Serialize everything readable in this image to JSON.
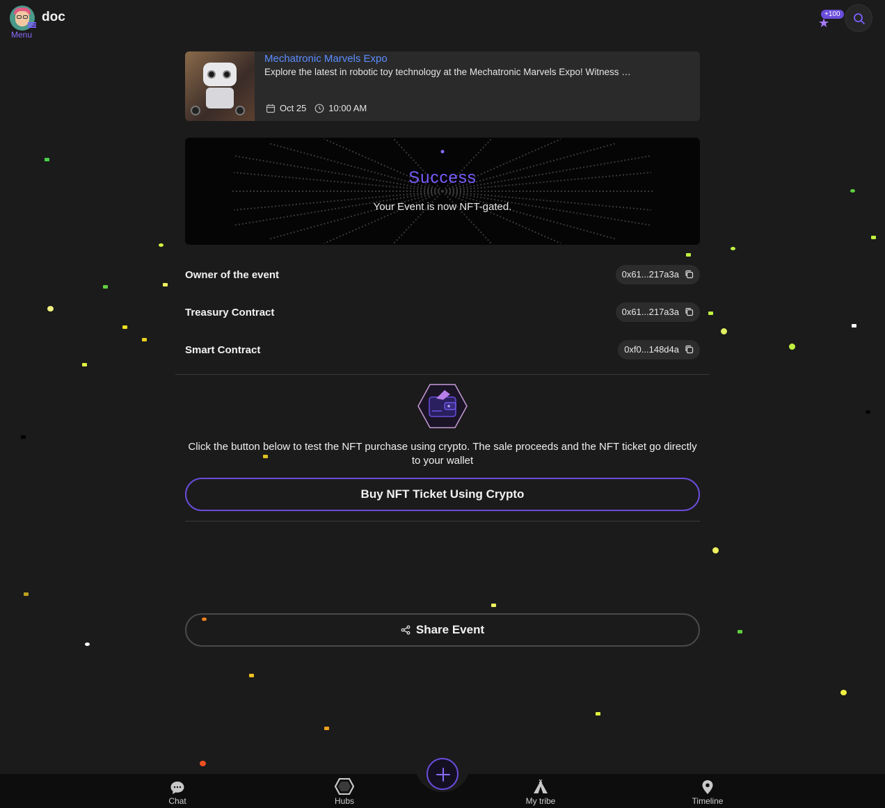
{
  "header": {
    "user_name": "doc",
    "menu_label": "Menu",
    "points_badge": "+100"
  },
  "event": {
    "title": "Mechatronic Marvels Expo",
    "description": "Explore the latest in robotic toy technology at the Mechatronic Marvels Expo! Witness …",
    "date": "Oct 25",
    "time": "10:00 AM"
  },
  "success": {
    "title": "Success",
    "message": "Your Event is now NFT-gated."
  },
  "contracts": [
    {
      "label": "Owner of the event",
      "address": "0x61...217a3a"
    },
    {
      "label": "Treasury Contract",
      "address": "0x61...217a3a"
    },
    {
      "label": "Smart Contract",
      "address": "0xf0...148d4a"
    }
  ],
  "purchase": {
    "info": "Click the button below to test the NFT purchase using crypto. The sale proceeds and the NFT ticket go directly to your wallet",
    "button_label": "Buy NFT Ticket Using Crypto"
  },
  "share": {
    "button_label": "Share Event"
  },
  "bottom_nav": {
    "items": [
      {
        "label": "Chat",
        "icon": "chat-bubble-icon"
      },
      {
        "label": "Hubs",
        "icon": "hexagon-icon"
      },
      {
        "label": "My tribe",
        "icon": "tent-icon"
      },
      {
        "label": "Timeline",
        "icon": "map-pin-icon"
      }
    ]
  },
  "colors": {
    "accent": "#6a4ddb",
    "link": "#5b8cff",
    "background": "#1b1b1b"
  }
}
